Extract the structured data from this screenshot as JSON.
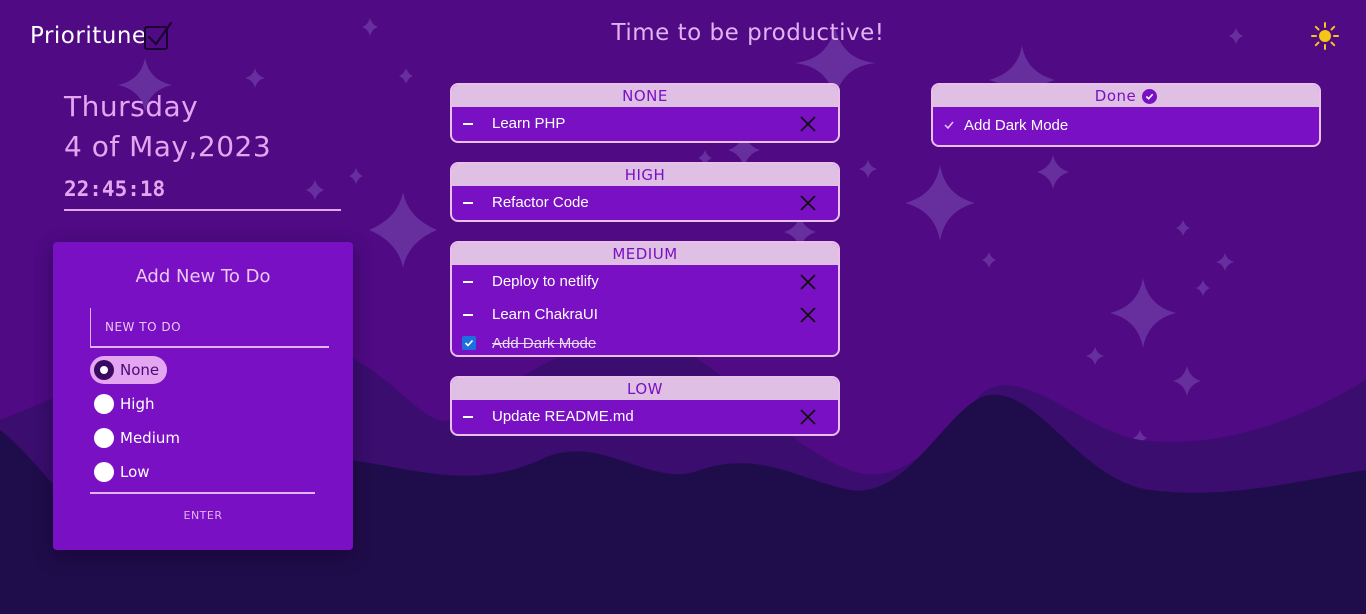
{
  "app": {
    "logo_text": "Prioritune",
    "header_title": "Time to be productive!"
  },
  "icons": {
    "logo": "checkbox-check-icon",
    "theme_toggle": "sun-icon",
    "delete": "close-icon",
    "done": "check-circle-icon"
  },
  "colors": {
    "background": "#4f0a84",
    "card": "#7a10c4",
    "accent": "#e4a6f0",
    "header_bar": "#dfbfe3",
    "mountains": "#1f0c4a",
    "sun": "#f5c518"
  },
  "datetime": {
    "day": "Thursday",
    "date": "4 of May,2023",
    "time": "22:45:18"
  },
  "add_form": {
    "title": "Add New To Do",
    "input_placeholder": "NEW TO DO",
    "input_value": "",
    "priorities": [
      {
        "label": "None",
        "selected": true
      },
      {
        "label": "High",
        "selected": false
      },
      {
        "label": "Medium",
        "selected": false
      },
      {
        "label": "Low",
        "selected": false
      }
    ],
    "submit_label": "ENTER"
  },
  "groups": [
    {
      "title": "NONE",
      "tasks": [
        {
          "text": "Learn PHP",
          "done": false
        }
      ]
    },
    {
      "title": "HIGH",
      "tasks": [
        {
          "text": "Refactor Code",
          "done": false
        }
      ]
    },
    {
      "title": "MEDIUM",
      "tasks": [
        {
          "text": "Deploy to netlify",
          "done": false
        },
        {
          "text": "Learn ChakraUI",
          "done": false
        },
        {
          "text": "Add Dark Mode",
          "done": true
        }
      ]
    },
    {
      "title": "LOW",
      "tasks": [
        {
          "text": "Update README.md",
          "done": false
        }
      ]
    }
  ],
  "done_list": {
    "title": "Done",
    "items": [
      "Add Dark Mode"
    ]
  }
}
